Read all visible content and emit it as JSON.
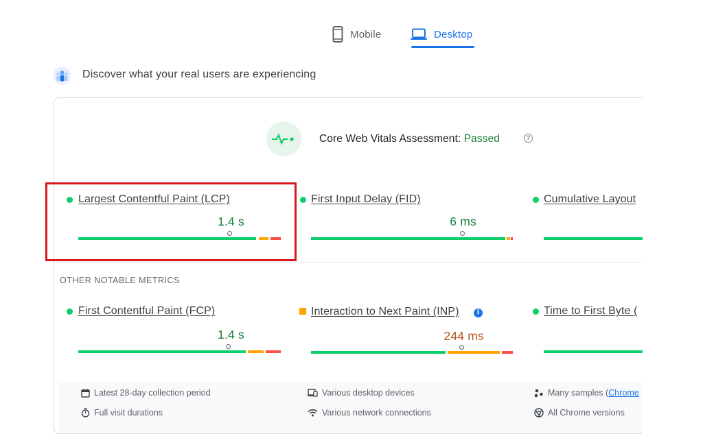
{
  "tabs": [
    {
      "label": "Mobile",
      "active": false
    },
    {
      "label": "Desktop",
      "active": true
    }
  ],
  "discover": {
    "text": "Discover what your real users are experiencing"
  },
  "assessment": {
    "label": "Core Web Vitals Assessment:",
    "status": "Passed",
    "help_icon": "?"
  },
  "core_metrics": [
    {
      "name": "Largest Contentful Paint (LCP)",
      "value": "1.4 s",
      "status": "good"
    },
    {
      "name": "First Input Delay (FID)",
      "value": "6 ms",
      "status": "good"
    },
    {
      "name": "Cumulative Layout",
      "value": "",
      "status": "good"
    }
  ],
  "other_section": {
    "label": "OTHER NOTABLE METRICS"
  },
  "other_metrics": [
    {
      "name": "First Contentful Paint (FCP)",
      "value": "1.4 s",
      "status": "good"
    },
    {
      "name": "Interaction to Next Paint (INP)",
      "value": "244 ms",
      "status": "needs-improvement",
      "info_icon": "i"
    },
    {
      "name": "Time to First Byte (",
      "value": "",
      "status": "good"
    }
  ],
  "footer": {
    "collection_period": "Latest 28-day collection period",
    "durations": "Full visit durations",
    "devices": "Various desktop devices",
    "connections": "Various network connections",
    "samples_prefix": "Many samples (",
    "samples_link": "Chrome",
    "versions": "All Chrome versions"
  },
  "colors": {
    "accent": "#1a73e8",
    "good": "#0cce6b",
    "average": "#ffa400",
    "poor": "#ff4e42",
    "passed_text": "#188038",
    "highlight": "#d7191f"
  }
}
